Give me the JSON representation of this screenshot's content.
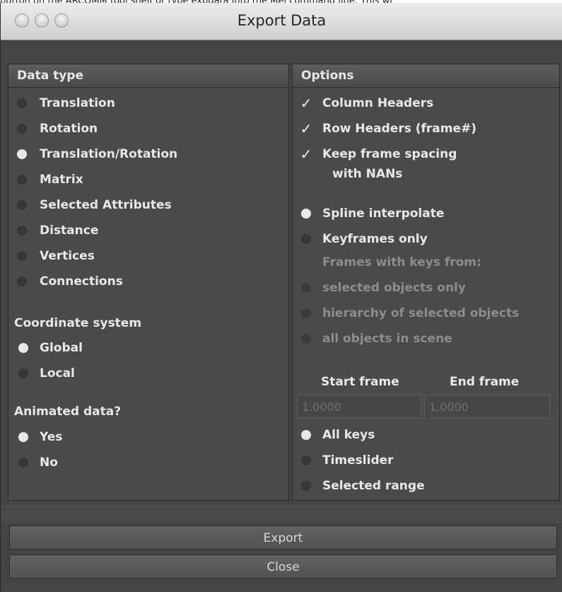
{
  "background_text": "button on the ARCOMM tool shelf or type expdata into the Mel command line. This wi",
  "window": {
    "title": "Export Data"
  },
  "data_type": {
    "header": "Data type",
    "options": [
      "Translation",
      "Rotation",
      "Translation/Rotation",
      "Matrix",
      "Selected Attributes",
      "Distance",
      "Vertices",
      "Connections"
    ],
    "selected": "Translation/Rotation"
  },
  "coordinate_system": {
    "label": "Coordinate system",
    "options": [
      "Global",
      "Local"
    ],
    "selected": "Global"
  },
  "animated_data": {
    "label": "Animated data?",
    "options": [
      "Yes",
      "No"
    ],
    "selected": "Yes"
  },
  "options": {
    "header": "Options",
    "column_headers": {
      "label": "Column Headers",
      "checked": true
    },
    "row_headers": {
      "label": "Row Headers (frame#)",
      "checked": true
    },
    "keep_spacing": {
      "label_line1": "Keep frame spacing",
      "label_line2": "with NANs",
      "checked": true
    },
    "interpolation": {
      "options": [
        "Spline interpolate",
        "Keyframes only"
      ],
      "selected": "Spline interpolate"
    },
    "keys_from": {
      "label": "Frames with keys from:",
      "options": [
        "selected objects only",
        "hierarchy of selected objects",
        "all objects in scene"
      ]
    },
    "start_frame": {
      "label": "Start frame",
      "value": "1.0000"
    },
    "end_frame": {
      "label": "End frame",
      "value": "1.0000"
    },
    "range": {
      "options": [
        "All keys",
        "Timeslider",
        "Selected range"
      ],
      "selected": "All keys"
    }
  },
  "buttons": {
    "export": "Export",
    "close": "Close"
  }
}
